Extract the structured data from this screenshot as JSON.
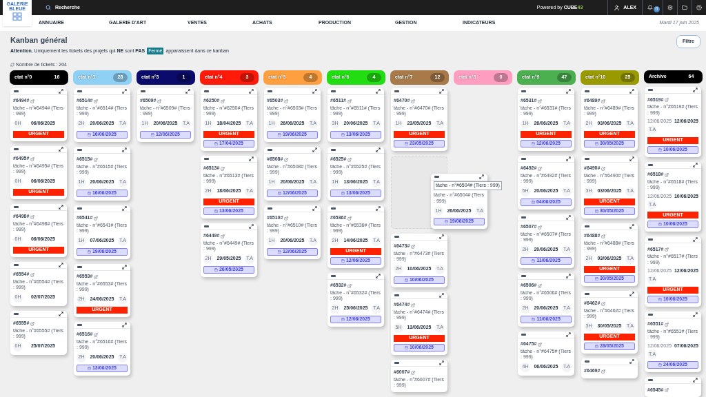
{
  "topbar": {
    "logo": "GALERIE BLEUE",
    "search_placeholder": "Recherche",
    "powered_prefix": "Powered by",
    "brand": "CUBE",
    "brand_suffix": "43",
    "user": "ALEX",
    "notifications": "0"
  },
  "nav": {
    "items": [
      "ANNUAIRE",
      "GALERIE D'ART",
      "VENTES",
      "ACHATS",
      "PRODUCTION",
      "GESTION",
      "INDICATEURS"
    ],
    "date": "Mardi 17 juin 2025"
  },
  "page": {
    "title": "Kanban général",
    "notice_before": "**Attention**, Uniquement les tickets des projets qui **NE** sont **PAS**",
    "notice_badge": "Fermé",
    "notice_after": "apparaissent dans ce kanban",
    "filter_button": "Filtre",
    "ticket_count": "Nombre de tickets : 204"
  },
  "columns": [
    {
      "name": "etat n°0",
      "count": "16",
      "color": "#000000",
      "cards": [
        {
          "kind": "card",
          "id": "#6494#",
          "description": "tâche - n°#6494# (Tiers : 999)",
          "hours": "0H",
          "date": "06/06/2025",
          "priority": "URGENT"
        },
        {
          "kind": "card",
          "id": "#6495#",
          "description": "tâche - n°#6495# (Tiers : 999)",
          "hours": "0H",
          "date": "06/06/2025",
          "priority": "URGENT"
        },
        {
          "kind": "card",
          "id": "#6498#",
          "description": "tâche - n°#6498# (Tiers : 999)",
          "hours": "0H",
          "date": "06/06/2025",
          "priority": "URGENT"
        },
        {
          "kind": "card",
          "id": "#6554#",
          "description": "tâche - n°#6554# (Tiers : 999)",
          "hours": "0H",
          "date": "02/07/2025"
        },
        {
          "kind": "card",
          "id": "#6555#",
          "description": "tâche - n°#6555# (Tiers : 999)",
          "hours": "0H",
          "date": "25/07/2025"
        }
      ]
    },
    {
      "name": "etat n°1",
      "count": "28",
      "color": "#8fd0f5",
      "cards": [
        {
          "kind": "card",
          "id": "#6514#",
          "description": "tâche - n°#6514# (Tiers : 999)",
          "hours": "2H",
          "date": "20/06/2025",
          "assignee": "T.A",
          "deadline": "16/06/2025"
        },
        {
          "kind": "card",
          "id": "#6515#",
          "description": "tâche - n°#6515# (Tiers : 999)",
          "hours": "1H",
          "date": "20/06/2025",
          "assignee": "T.A",
          "deadline": "16/06/2025"
        },
        {
          "kind": "card",
          "id": "#6541#",
          "description": "tâche - n°#6541# (Tiers : 999)",
          "hours": "1H",
          "date": "07/06/2025",
          "assignee": "T.A",
          "deadline": "19/06/2025"
        },
        {
          "kind": "card",
          "id": "#6553#",
          "description": "tâche - n°#6553# (Tiers : 999)",
          "hours": "2H",
          "date": "24/06/2025",
          "assignee": "T.A",
          "priority": "URGENT"
        },
        {
          "kind": "card",
          "id": "#6516#",
          "description": "tâche - n°#6516# (Tiers : 999)",
          "hours": "2H",
          "date": "20/06/2025",
          "assignee": "T.A",
          "deadline": "13/06/2025"
        }
      ]
    },
    {
      "name": "etat n°3",
      "count": "1",
      "color": "#0b0b6b",
      "cards": [
        {
          "kind": "card",
          "id": "#6509#",
          "description": "tâche - n°#6509# (Tiers : 999)",
          "hours": "1H",
          "date": "20/06/2025",
          "assignee": "T.A",
          "deadline": "12/06/2025"
        }
      ]
    },
    {
      "name": "etat n°4",
      "count": "3",
      "color": "#ff1a0a",
      "cards": [
        {
          "kind": "card",
          "id": "#6250#",
          "description": "tâche - n°#6250# (Tiers : 999)",
          "hours": "1H",
          "date": "18/04/2025",
          "assignee": "T.A",
          "priority": "URGENT",
          "deadline": "17/04/2025"
        },
        {
          "kind": "card",
          "id": "#6513#",
          "description": "tâche - n°#6513# (Tiers : 999)",
          "hours": "2H",
          "date": "18/06/2025",
          "assignee": "T.A",
          "priority": "URGENT",
          "deadline": "13/06/2025"
        },
        {
          "kind": "card",
          "id": "#6449#",
          "description": "tâche - n°#6449# (Tiers : 999)",
          "hours": "2H",
          "date": "29/05/2025",
          "assignee": "T.A",
          "deadline": "26/05/2025"
        }
      ]
    },
    {
      "name": "etat n°5",
      "count": "4",
      "color": "#ffa040",
      "cards": [
        {
          "kind": "card",
          "id": "#6503#",
          "description": "tâche - n°#6503# (Tiers : 999)",
          "hours": "1H",
          "date": "26/06/2025",
          "assignee": "T.A",
          "deadline": "19/06/2025"
        },
        {
          "kind": "card",
          "id": "#6508#",
          "description": "tâche - n°#6508# (Tiers : 999)",
          "hours": "1H",
          "date": "20/06/2025",
          "assignee": "T.A",
          "deadline": "12/06/2025"
        },
        {
          "kind": "card",
          "id": "#6510#",
          "description": "tâche - n°#6510# (Tiers : 999)",
          "hours": "1H",
          "date": "20/06/2025",
          "assignee": "T.A",
          "deadline": "12/06/2025"
        }
      ]
    },
    {
      "name": "etat n°6",
      "count": "4",
      "color": "#22dd11",
      "cards": [
        {
          "kind": "card",
          "id": "#6511#",
          "description": "tâche - n°#6511# (Tiers : 999)",
          "hours": "3H",
          "date": "20/06/2025",
          "assignee": "T.A",
          "deadline": "13/06/2025"
        },
        {
          "kind": "card",
          "id": "#6525#",
          "description": "tâche - n°#6525# (Tiers : 999)",
          "hours": "1H",
          "date": "13/06/2025",
          "assignee": "T.A",
          "deadline": "13/06/2025"
        },
        {
          "kind": "card",
          "id": "#6536#",
          "description": "tâche - n°#6536# (Tiers : 999)",
          "hours": "2H",
          "date": "14/06/2025",
          "assignee": "T.A",
          "priority": "URGENT",
          "deadline": "12/06/2025"
        },
        {
          "kind": "card",
          "id": "#6532#",
          "description": "tâche - n°#6532# (Tiers : 999)",
          "hours": "2H",
          "date": "25/06/2025",
          "assignee": "T.A",
          "deadline": "12/06/2025"
        }
      ]
    },
    {
      "name": "etat n°7",
      "count": "12",
      "color": "#a87a4a",
      "cards": [
        {
          "kind": "card",
          "id": "#6470#",
          "description": "tâche - n°#6470# (Tiers : 999)",
          "hours": "1H",
          "date": "23/05/2025",
          "assignee": "T.A",
          "priority": "URGENT",
          "deadline": "23/05/2025"
        },
        {
          "kind": "placeholder"
        },
        {
          "kind": "card",
          "id": "#6473#",
          "description": "tâche - n°#6473# (Tiers : 999)",
          "hours": "2H",
          "date": "10/06/2025",
          "assignee": "T.A",
          "deadline": "10/06/2025"
        },
        {
          "kind": "card",
          "id": "#6474#",
          "description": "tâche - n°#6474# (Tiers : 999)",
          "hours": "5H",
          "date": "13/06/2025",
          "assignee": "T.A",
          "priority": "URGENT",
          "deadline": "10/06/2025"
        },
        {
          "kind": "card",
          "id": "#6007#",
          "description": "tâche - n°#6007# (Tiers : 999)"
        }
      ]
    },
    {
      "name": "etat n°8",
      "count": "0",
      "color": "#ff9ec0"
    },
    {
      "name": "etat n°9",
      "count": "47",
      "color": "#4caf50",
      "cards": [
        {
          "kind": "card",
          "id": "#6531#",
          "description": "tâche - n°#6531# (Tiers : 999)",
          "hours": "1H",
          "date": "26/06/2025",
          "assignee": "T.A",
          "priority": "URGENT",
          "deadline": "12/06/2025"
        },
        {
          "kind": "card",
          "id": "#6492#",
          "description": "tâche - n°#6492# (Tiers : 999)",
          "hours": "5H",
          "date": "20/06/2025",
          "assignee": "T.A",
          "deadline": "04/06/2025"
        },
        {
          "kind": "card",
          "id": "#6507#",
          "description": "tâche - n°#6507# (Tiers : 999)",
          "hours": "2H",
          "date": "20/06/2025",
          "assignee": "T.A",
          "deadline": "11/06/2025"
        },
        {
          "kind": "card",
          "id": "#6506#",
          "description": "tâche - n°#6506# (Tiers : 999)",
          "hours": "2H",
          "date": "20/06/2025",
          "assignee": "T.A",
          "deadline": "11/06/2025"
        },
        {
          "kind": "card",
          "id": "#6475#",
          "description": "tâche - n°#6475# (Tiers : 999)",
          "hours": "4H",
          "date": "06/06/2025",
          "assignee": "T.A"
        }
      ]
    },
    {
      "name": "etat n°10",
      "count": "25",
      "color": "#999900",
      "cards": [
        {
          "kind": "card",
          "id": "#6489#",
          "description": "tâche - n°#6489# (Tiers : 999)",
          "hours": "2H",
          "date": "03/06/2025",
          "assignee": "T.A",
          "priority": "URGENT",
          "deadline": "30/05/2025"
        },
        {
          "kind": "card",
          "id": "#6490#",
          "description": "tâche - n°#6490# (Tiers : 999)",
          "hours": "3H",
          "date": "03/06/2025",
          "assignee": "T.A",
          "priority": "URGENT",
          "deadline": "30/05/2025"
        },
        {
          "kind": "card",
          "id": "#6488#",
          "description": "tâche - n°#6488# (Tiers : 999)",
          "hours": "2H",
          "date": "03/06/2025",
          "assignee": "T.A",
          "priority": "URGENT",
          "deadline": "30/05/2025"
        },
        {
          "kind": "card",
          "id": "#6462#",
          "description": "tâche - n°#6462# (Tiers : 999)",
          "hours": "3H",
          "date": "30/05/2025",
          "assignee": "T.A",
          "priority": "URGENT",
          "deadline": "28/05/2025"
        },
        {
          "kind": "card",
          "id": "#6469#"
        }
      ]
    },
    {
      "name": "Archive",
      "count": "64",
      "color": "#000000",
      "cards": [
        {
          "kind": "card",
          "id": "#6519#",
          "description": "tâche - n°#6519# (Tiers : 999)",
          "previous_date": "12/06/2025",
          "date": "12/06/2025",
          "assignee": "T.A",
          "priority": "URGENT",
          "deadline": "10/06/2025"
        },
        {
          "kind": "card",
          "id": "#6518#",
          "description": "tâche - n°#6518# (Tiers : 999)",
          "previous_date": "12/06/2025",
          "date": "10/06/2025",
          "assignee": "T.A",
          "priority": "URGENT",
          "deadline": "10/06/2025"
        },
        {
          "kind": "card",
          "id": "#6517#",
          "description": "tâche - n°#6517# (Tiers : 999)",
          "previous_date": "12/06/2025",
          "date": "12/06/2025",
          "assignee": "T.A",
          "priority": "URGENT",
          "deadline": "10/06/2025"
        },
        {
          "kind": "card",
          "id": "#6551#",
          "description": "tâche - n°#6551# (Tiers : 999)",
          "previous_date": "12/06/2025",
          "date": "07/06/2025",
          "assignee": "T.A",
          "deadline": "24/06/2025"
        },
        {
          "kind": "card",
          "id": "#6545#"
        }
      ]
    }
  ],
  "dragged_card": {
    "tooltip": "tâche - n°#6504# (Tiers : 999)",
    "description": "tâche - n°#6504# (Tiers : 999)",
    "hours": "1H",
    "date": "26/06/2025",
    "assignee": "T.A",
    "deadline": "19/06/2025"
  }
}
